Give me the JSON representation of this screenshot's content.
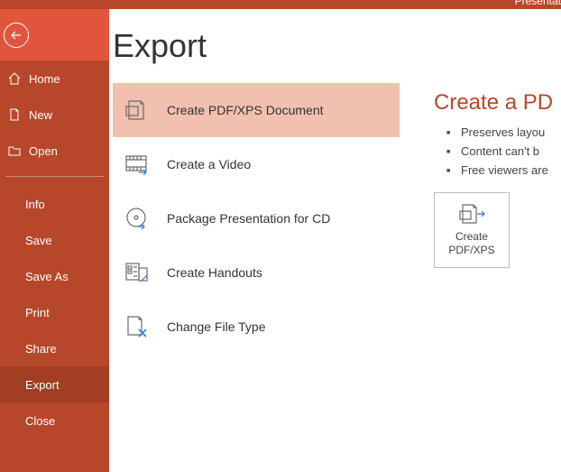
{
  "titlebar": {
    "title": "Presentat"
  },
  "sidebar": {
    "items": [
      {
        "label": "Home"
      },
      {
        "label": "New"
      },
      {
        "label": "Open"
      },
      {
        "label": "Info"
      },
      {
        "label": "Save"
      },
      {
        "label": "Save As"
      },
      {
        "label": "Print"
      },
      {
        "label": "Share"
      },
      {
        "label": "Export"
      },
      {
        "label": "Close"
      }
    ]
  },
  "page": {
    "title": "Export"
  },
  "options": [
    {
      "label": "Create PDF/XPS Document"
    },
    {
      "label": "Create a Video"
    },
    {
      "label": "Package Presentation for CD"
    },
    {
      "label": "Create Handouts"
    },
    {
      "label": "Change File Type"
    }
  ],
  "right": {
    "title": "Create a PD",
    "bullets": [
      "Preserves layou",
      "Content can't b",
      "Free viewers are"
    ],
    "button_label_1": "Create",
    "button_label_2": "PDF/XPS"
  }
}
